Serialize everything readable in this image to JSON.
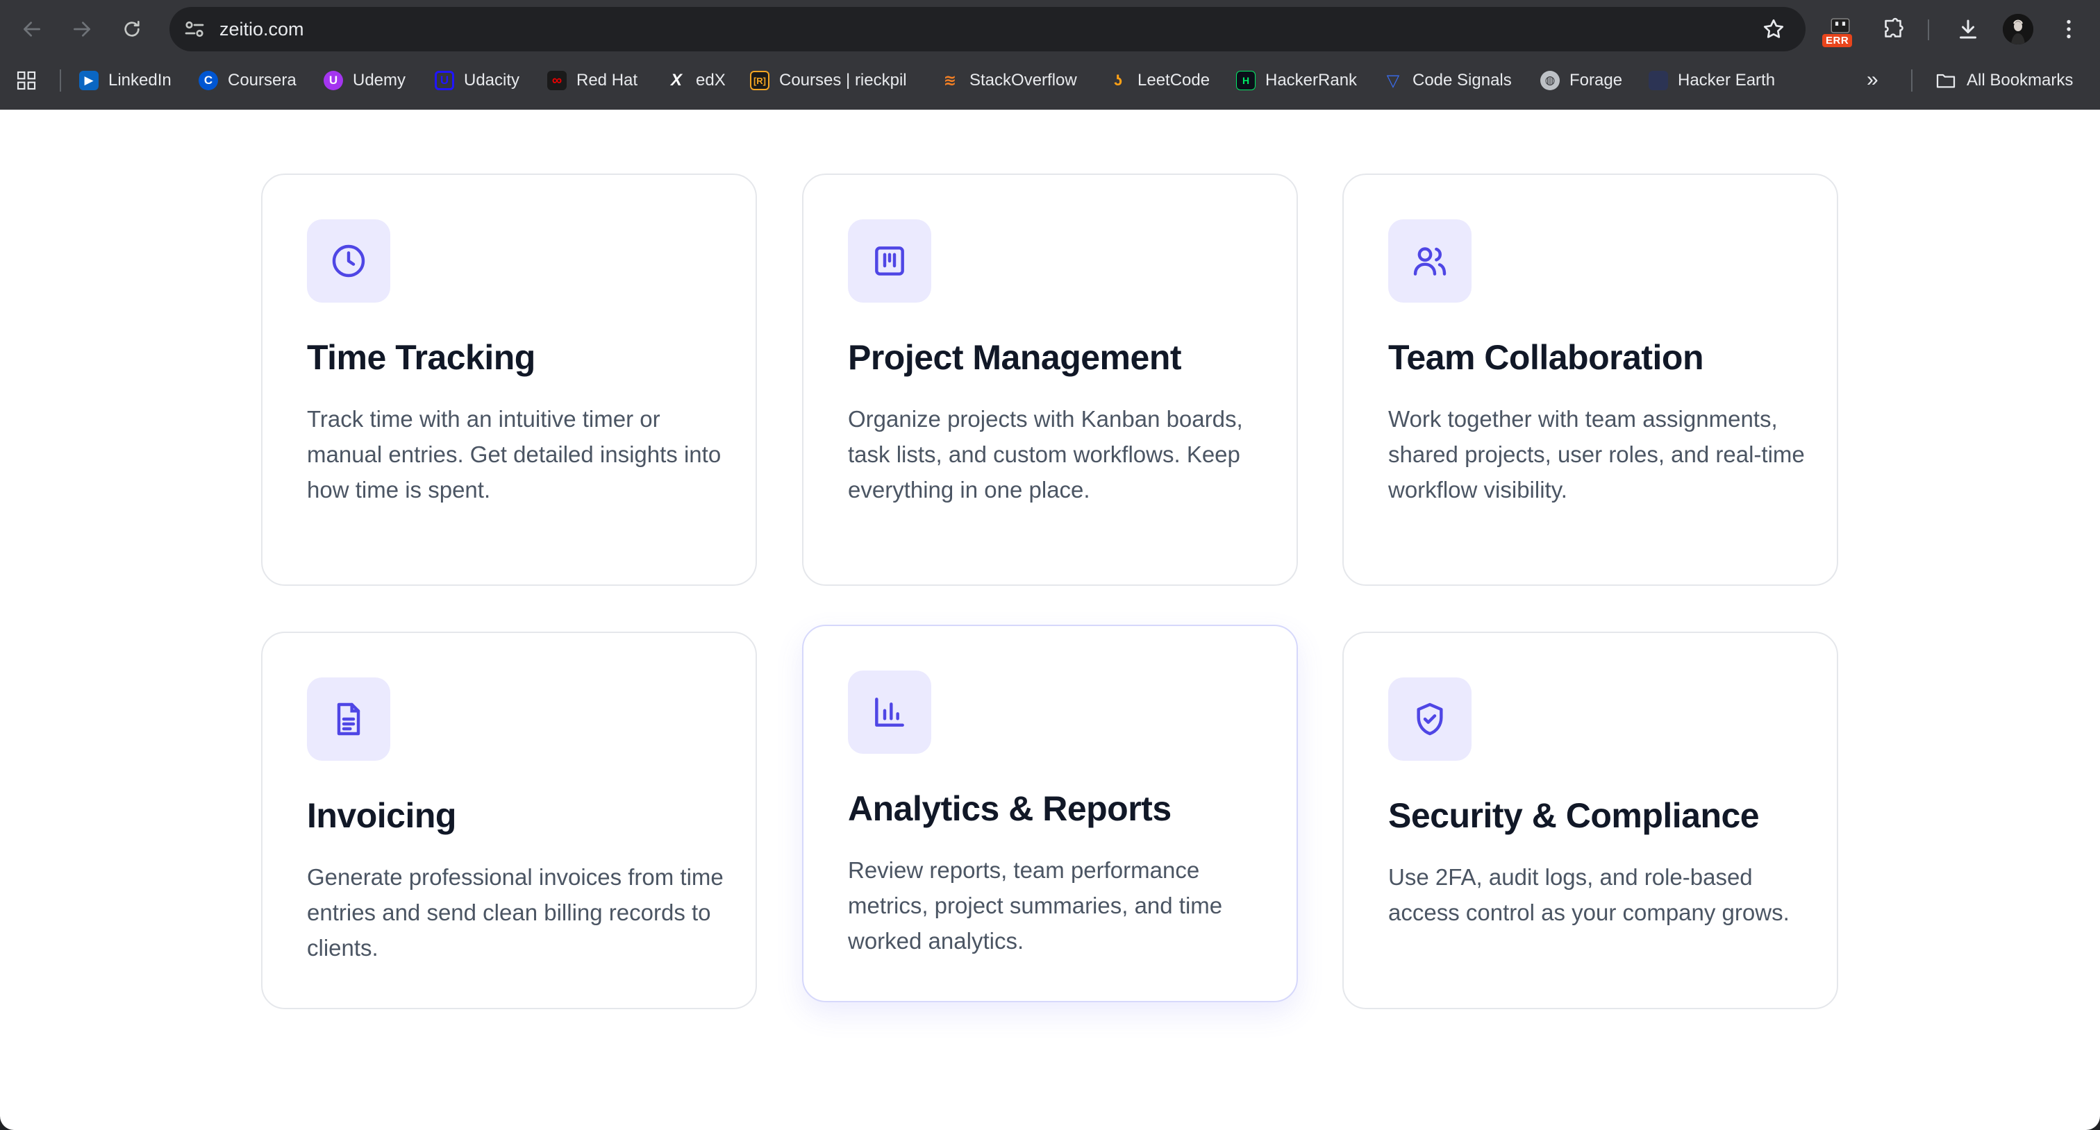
{
  "browser": {
    "url": "zeitio.com",
    "extension_badge": "ERR",
    "bookmarks": [
      {
        "label": "LinkedIn",
        "icon": "linkedin-icon",
        "color": "#0a66c2"
      },
      {
        "label": "Coursera",
        "icon": "coursera-icon",
        "color": "#0056d2"
      },
      {
        "label": "Udemy",
        "icon": "udemy-icon",
        "color": "#a435f0"
      },
      {
        "label": "Udacity",
        "icon": "udacity-icon",
        "color": "#2015ff"
      },
      {
        "label": "Red Hat",
        "icon": "redhat-icon",
        "color": "#ee0000"
      },
      {
        "label": "edX",
        "icon": "edx-icon",
        "color": "#ffffff"
      },
      {
        "label": "Courses | rieckpil",
        "icon": "rieckpil-icon",
        "color": "#f5a623"
      },
      {
        "label": "StackOverflow",
        "icon": "stackoverflow-icon",
        "color": "#f48024"
      },
      {
        "label": "LeetCode",
        "icon": "leetcode-icon",
        "color": "#ffa116"
      },
      {
        "label": "HackerRank",
        "icon": "hackerrank-icon",
        "color": "#00ea64"
      },
      {
        "label": "Code Signals",
        "icon": "codesignal-icon",
        "color": "#3a6df0"
      },
      {
        "label": "Forage",
        "icon": "forage-icon",
        "color": "#bdc1c6"
      },
      {
        "label": "Hacker Earth",
        "icon": "hackerearth-icon",
        "color": "#2c3454"
      }
    ],
    "all_bookmarks_label": "All Bookmarks"
  },
  "features": [
    {
      "title": "Time Tracking",
      "description": "Track time with an intuitive timer or manual entries. Get detailed insights into how time is spent.",
      "icon": "clock-icon"
    },
    {
      "title": "Project Management",
      "description": "Organize projects with Kanban boards, task lists, and custom workflows. Keep everything in one place.",
      "icon": "kanban-icon"
    },
    {
      "title": "Team Collaboration",
      "description": "Work together with team assignments, shared projects, user roles, and real-time workflow visibility.",
      "icon": "users-icon"
    },
    {
      "title": "Invoicing",
      "description": "Generate professional invoices from time entries and send clean billing records to clients.",
      "icon": "document-icon"
    },
    {
      "title": "Analytics & Reports",
      "description": "Review reports, team performance metrics, project summaries, and time worked analytics.",
      "icon": "bar-chart-icon"
    },
    {
      "title": "Security & Compliance",
      "description": "Use 2FA, audit logs, and role-based access control as your company grows.",
      "icon": "shield-check-icon"
    }
  ],
  "colors": {
    "accent": "#4f46e5",
    "icon_bg": "#ebeafe",
    "heading": "#111827",
    "body_text": "#4b5563",
    "card_border": "#e5e7eb"
  }
}
